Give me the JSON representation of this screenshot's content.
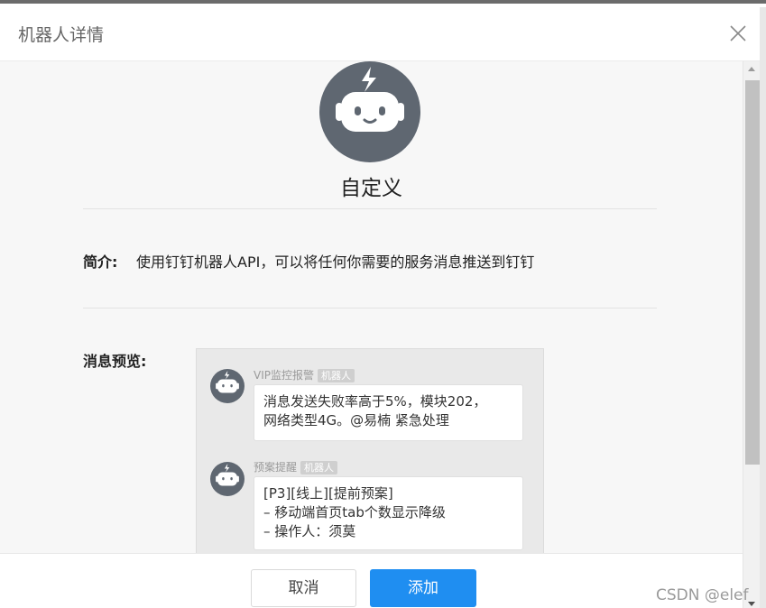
{
  "dialog": {
    "title": "机器人详情",
    "close_icon": "close-icon"
  },
  "robot": {
    "name": "自定义",
    "avatar_icon": "robot-icon",
    "avatar_color": "#5f6771"
  },
  "intro": {
    "label": "简介:",
    "text": "使用钉钉机器人API，可以将任何你需要的服务消息推送到钉钉"
  },
  "preview": {
    "label": "消息预览:",
    "messages": [
      {
        "sender": "VIP监控报警",
        "tag": "机器人",
        "lines": [
          "消息发送失败率高于5%，模块202，",
          "网络类型4G。@易楠 紧急处理"
        ]
      },
      {
        "sender": "预案提醒",
        "tag": "机器人",
        "lines": [
          "[P3][线上][提前预案]",
          "– 移动端首页tab个数显示降级",
          "– 操作人：须莫"
        ]
      }
    ]
  },
  "footer": {
    "cancel_label": "取消",
    "add_label": "添加",
    "primary_color": "#1f8ef1"
  },
  "watermark": "CSDN @elef"
}
